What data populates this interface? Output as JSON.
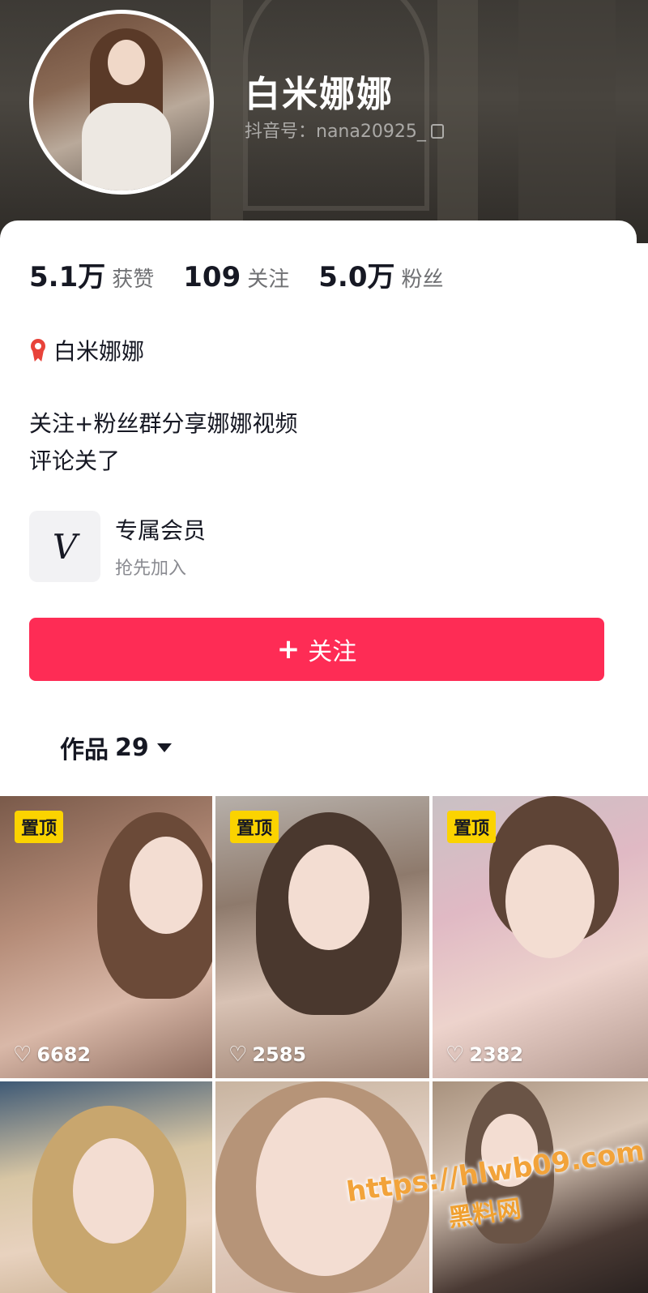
{
  "profile": {
    "name": "白米娜娜",
    "douyin_id": "抖音号：nana20925_"
  },
  "stats": [
    {
      "value": "5.1万",
      "label": "获赞"
    },
    {
      "value": "109",
      "label": "关注"
    },
    {
      "value": "5.0万",
      "label": "粉丝"
    }
  ],
  "tag": {
    "icon": "red-ribbon-icon",
    "text": "白米娜娜"
  },
  "bio": {
    "line1": "关注+粉丝群分享娜娜视频",
    "line2": "评论关了"
  },
  "membership": {
    "icon": "v-logo-icon",
    "title": "专属会员",
    "subtitle": "抢先加入"
  },
  "follow_button": {
    "plus": "+",
    "label": "关注",
    "color": "#fe2c55"
  },
  "works": {
    "label": "作品",
    "count": "29"
  },
  "videos": [
    {
      "pinned": "置顶",
      "likes": "6682"
    },
    {
      "pinned": "置顶",
      "likes": "2585"
    },
    {
      "pinned": "置顶",
      "likes": "2382"
    },
    {
      "pinned": "",
      "likes": ""
    },
    {
      "pinned": "",
      "likes": ""
    },
    {
      "pinned": "",
      "likes": ""
    }
  ],
  "watermark": {
    "url": "https://hlwb09.com",
    "site": "黑料网"
  },
  "colors": {
    "accent": "#fe2c55",
    "pinned_badge": "#fbd300"
  }
}
